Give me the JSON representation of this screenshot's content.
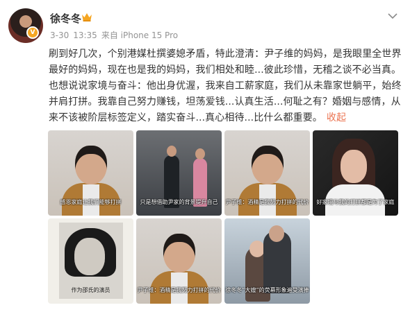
{
  "user": {
    "name": "徐冬冬",
    "badge_icon": "crown-icon",
    "verified_icon": "verified-v-icon",
    "verified_color": "#f6a623"
  },
  "meta": {
    "date": "3-30",
    "time": "13:35",
    "source": "来自 iPhone 15 Pro"
  },
  "post": {
    "text": "刷到好几次，个别港媒杜撰婆媳矛盾，特此澄清：尹子维的妈妈，是我眼里全世界最好的妈妈，现在也是我的妈妈，我们相处和睦...彼此珍惜，无稽之谈不必当真。也想说说家境与奋斗：他出身优渥，我来自工薪家庭，我们从未靠家世躺平，始终并肩打拼。我靠自己努力赚钱，坦荡爱钱...认真生活...何耻之有？婚姻与感情，从来不该被阶层标签定义，踏实奋斗...真心相待...比什么都重要。",
    "collapse_label": "收起",
    "accent_color": "#eb7350"
  },
  "images": [
    {
      "caption": "感恩家庭让我们能够打拼",
      "kind": "man"
    },
    {
      "caption": "只是想借助尹家的背景提升自己",
      "kind": "stage"
    },
    {
      "caption": "尹子维：酒精是我努力打拼的代价",
      "kind": "man"
    },
    {
      "caption": "好家境与我的打拼都是为了家庭",
      "kind": "lady"
    },
    {
      "caption": "作为邵氏的演员",
      "kind": "bw"
    },
    {
      "caption": "尹子维：酒精是我努力打拼的代价",
      "kind": "man"
    },
    {
      "caption": "徐冬冬“大嫂”的荧幕形象遍受演捧",
      "kind": "couple"
    }
  ]
}
